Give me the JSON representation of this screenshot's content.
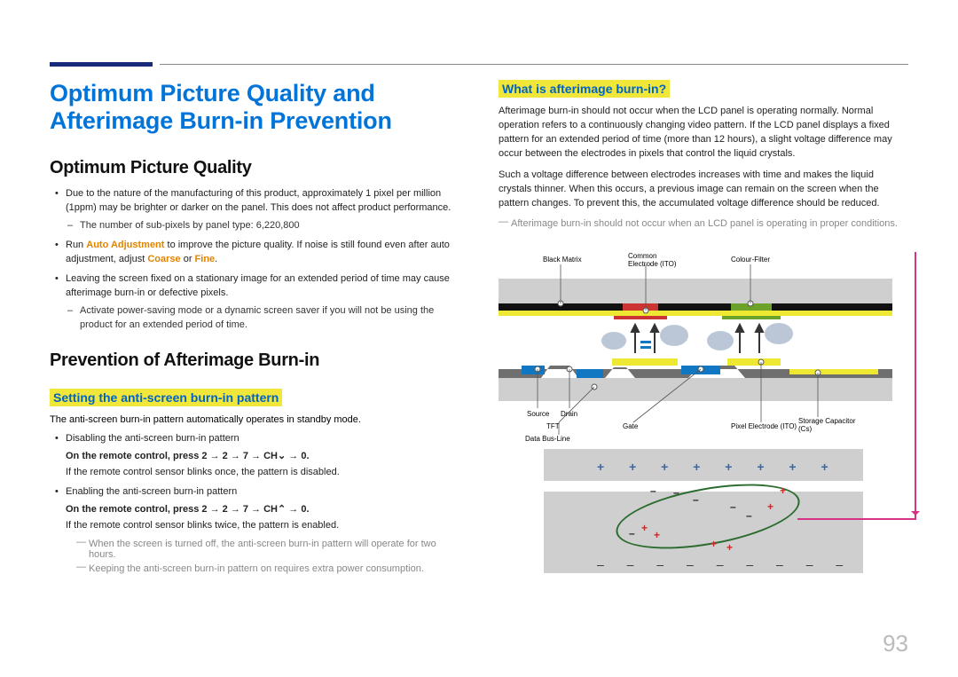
{
  "page_number": "93",
  "main_title": "Optimum Picture Quality and Afterimage Burn-in Prevention",
  "left": {
    "h2a": "Optimum Picture Quality",
    "bullets_a": [
      "Due to the nature of the manufacturing of this product, approximately 1 pixel per million (1ppm) may be brighter or darker on the panel. This does not affect product performance."
    ],
    "sub_a1": "The number of sub-pixels by panel type: 6,220,800",
    "run_prefix": "Run ",
    "run_cmd": "Auto Adjustment",
    "run_rest1": " to improve the picture quality. If noise is still found even after auto adjustment, adjust ",
    "coarse": "Coarse",
    "or_word": " or ",
    "fine": "Fine",
    "dot": ".",
    "bullets_a3": "Leaving the screen fixed on a stationary image for an extended period of time may cause afterimage burn-in or defective pixels.",
    "sub_a3": "Activate power-saving mode or a dynamic screen saver if you will not be using the product for an extended period of time.",
    "h2b": "Prevention of Afterimage Burn-in",
    "h3a": "Setting the anti-screen burn-in pattern",
    "intro": "The anti-screen burn-in pattern automatically operates in standby mode.",
    "li_disable": "Disabling the anti-screen burn-in pattern",
    "remote_down": "On the remote control, press 2 → 2 → 7 → CH⌄ → 0.",
    "remote_down_after": "If the remote control sensor blinks once, the pattern is disabled.",
    "li_enable": "Enabling the anti-screen burn-in pattern",
    "remote_up": "On the remote control, press 2 → 2 → 7 → CH⌃ → 0.",
    "remote_up_after": "If the remote control sensor blinks twice, the pattern is enabled.",
    "note1": "When the screen is turned off, the anti-screen burn-in pattern will operate for two hours.",
    "note2": "Keeping the anti-screen burn-in pattern on requires extra power consumption."
  },
  "right": {
    "h3": "What is afterimage burn-in?",
    "p1": "Afterimage burn-in should not occur when the LCD panel is operating normally. Normal operation refers to a continuously changing video pattern. If the LCD panel displays a fixed pattern for an extended period of time (more than 12 hours), a slight voltage difference may occur between the electrodes in pixels that control the liquid crystals.",
    "p2": "Such a voltage difference between electrodes increases with time and makes the liquid crystals thinner. When this occurs, a previous image can remain on the screen when the pattern changes. To prevent this, the accumulated voltage difference should be reduced.",
    "note": "Afterimage burn-in should not occur when an LCD panel is operating in proper conditions.",
    "labels": {
      "black_matrix": "Black Matrix",
      "common_electrode": "Common Electrode (ITO)",
      "colour_filter": "Colour-Filter",
      "source": "Source",
      "drain": "Drain",
      "tft": "TFT",
      "data_bus": "Data Bus-Line",
      "gate": "Gate",
      "pixel_electrode": "Pixel Electrode (ITO)",
      "storage_cap": "Storage Capacitor (Cs)"
    },
    "plus_row": "+ + + + + + + +",
    "minus_row": "– – – – – – – – –"
  }
}
